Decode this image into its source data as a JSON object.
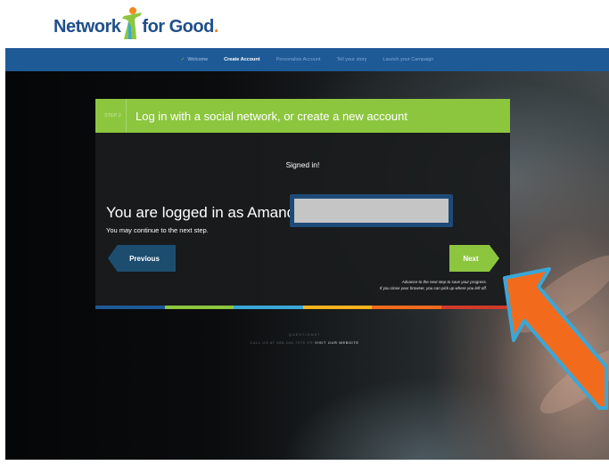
{
  "logo": {
    "part1": "Network",
    "part2": "for Good",
    "dot": "."
  },
  "nav": {
    "items": [
      {
        "label": "Welcome",
        "state": "done"
      },
      {
        "label": "Create Account",
        "state": "active"
      },
      {
        "label": "Personalize Account",
        "state": "pending"
      },
      {
        "label": "Tell your story",
        "state": "pending"
      },
      {
        "label": "Launch your Campaign",
        "state": "pending"
      }
    ]
  },
  "modal": {
    "step_label": "STEP 2",
    "title": "Log in with a social network, or create a new account",
    "signed_in": "Signed in!",
    "logged_in_as": "You are logged in as Amanda",
    "continue_msg": "You may continue to the next step.",
    "previous_label": "Previous",
    "next_label": "Next",
    "advance_line1": "Advance to the next step to save your progress.",
    "advance_line2": "If you close your browser, you can pick up where you left off."
  },
  "footer": {
    "questions": "QUESTIONS?",
    "call_prefix": "CALL US AT 888-284-7978 OR",
    "visit_link": "VISIT OUR WEBSITE"
  },
  "colors": {
    "nav_bg": "#1e5a96",
    "accent_green": "#8cc63f",
    "prev_button": "#1d4d6e",
    "arrow_fill": "#f26b1d",
    "arrow_stroke": "#3aa7d8",
    "redaction_border": "#1e4a78",
    "stripe": [
      "#1e5a96",
      "#8cc63f",
      "#3aa7d8",
      "#f7b21e",
      "#f26b1d",
      "#d23a2a"
    ]
  },
  "icons": {
    "check": "check-icon",
    "logo_figure": "person-figure-icon",
    "annotation_arrow": "arrow-annotation-icon"
  }
}
